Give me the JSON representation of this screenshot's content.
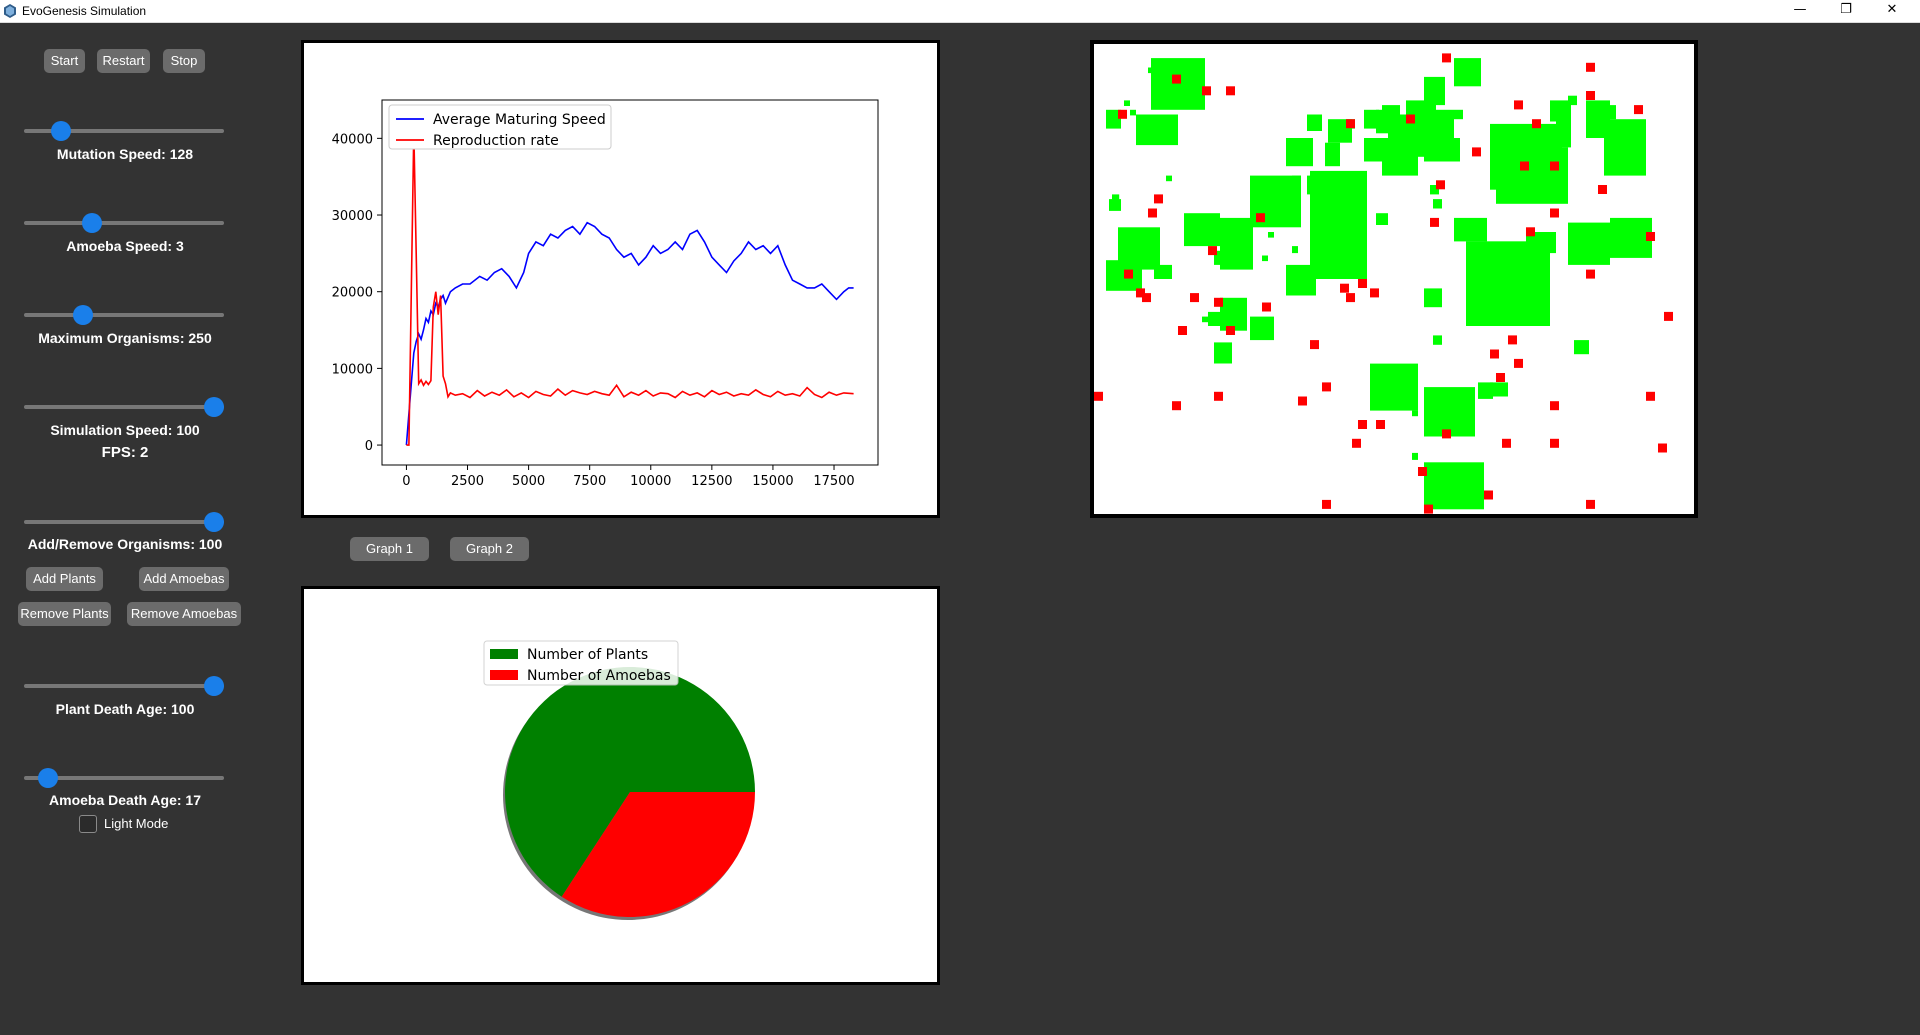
{
  "window": {
    "title": "EvoGenesis Simulation",
    "controls": {
      "minimize": "—",
      "restore": "❐",
      "close": "✕"
    }
  },
  "sidebar": {
    "buttons": {
      "start": "Start",
      "restart": "Restart",
      "stop": "Stop"
    },
    "sliders": {
      "mutation_speed": {
        "label": "Mutation Speed: 128",
        "level": 0.15
      },
      "amoeba_speed": {
        "label": "Amoeba Speed: 3",
        "level": 0.32
      },
      "max_organisms": {
        "label": "Maximum Organisms: 250",
        "level": 0.27
      },
      "simulation_speed": {
        "label": "Simulation Speed: 100",
        "level": 1.0
      },
      "add_remove": {
        "label": "Add/Remove Organisms: 100",
        "level": 1.0
      },
      "plant_death_age": {
        "label": "Plant Death Age: 100",
        "level": 1.0
      },
      "amoeba_death_age": {
        "label": "Amoeba Death Age: 17",
        "level": 0.08
      }
    },
    "fps": "FPS: 2",
    "organism_buttons": {
      "add_plants": "Add Plants",
      "add_amoebas": "Add Amoebas",
      "remove_plants": "Remove Plants",
      "remove_amoebas": "Remove Amoebas"
    },
    "light_mode": {
      "label": "Light Mode",
      "checked": false
    }
  },
  "graph_buttons": {
    "graph1": "Graph 1",
    "graph2": "Graph 2"
  },
  "colors": {
    "maturing": "#0000ff",
    "reproduction": "#ff0000",
    "plants": "#008000",
    "amoebas": "#ff0000",
    "grid_plant": "#00ff00",
    "grid_amoeba": "#ff0000",
    "slider_thumb": "#1a7fea",
    "background": "#333333"
  },
  "chart_data": [
    {
      "type": "line",
      "xlim": [
        -1000,
        19300
      ],
      "ylim": [
        -2600,
        45000
      ],
      "xticks": [
        0,
        2500,
        5000,
        7500,
        10000,
        12500,
        15000,
        17500
      ],
      "yticks": [
        0,
        10000,
        20000,
        30000,
        40000
      ],
      "legend_position": "upper-left",
      "series": [
        {
          "name": "Average Maturing Speed",
          "x": [
            0,
            200,
            300,
            400,
            500,
            600,
            700,
            800,
            900,
            1000,
            1100,
            1200,
            1300,
            1400,
            1500,
            1600,
            1800,
            2000,
            2300,
            2600,
            3000,
            3300,
            3600,
            3900,
            4200,
            4500,
            4800,
            5000,
            5300,
            5600,
            5900,
            6200,
            6500,
            6800,
            7100,
            7400,
            7700,
            8000,
            8300,
            8600,
            8900,
            9200,
            9500,
            9800,
            10100,
            10400,
            10700,
            11000,
            11300,
            11600,
            11900,
            12200,
            12500,
            12800,
            13100,
            13400,
            13700,
            14000,
            14300,
            14600,
            14900,
            15200,
            15500,
            15800,
            16100,
            16400,
            16700,
            17000,
            17300,
            17600,
            17900,
            18100,
            18300
          ],
          "y": [
            0,
            8000,
            12000,
            13500,
            14500,
            13800,
            15000,
            16500,
            16000,
            17500,
            17000,
            18500,
            18000,
            19000,
            19500,
            18500,
            20000,
            20500,
            21000,
            21000,
            22000,
            21500,
            22500,
            23000,
            22000,
            20500,
            22500,
            25000,
            26500,
            26000,
            27500,
            27000,
            28000,
            28500,
            27500,
            29000,
            28500,
            27500,
            27000,
            25500,
            24500,
            25000,
            23500,
            24500,
            26000,
            25000,
            25500,
            26500,
            25500,
            27500,
            28000,
            26500,
            24500,
            23500,
            22500,
            24000,
            25000,
            26500,
            25500,
            26000,
            25000,
            26000,
            23500,
            21500,
            21000,
            20500,
            20500,
            21000,
            20000,
            19000,
            20000,
            20500,
            20500
          ]
        },
        {
          "name": "Reproduction rate",
          "x": [
            0,
            100,
            200,
            300,
            400,
            500,
            600,
            700,
            800,
            900,
            1000,
            1100,
            1200,
            1300,
            1400,
            1500,
            1600,
            1700,
            1800,
            2000,
            2300,
            2600,
            2900,
            3200,
            3500,
            3800,
            4100,
            4400,
            4700,
            5000,
            5300,
            5600,
            5900,
            6200,
            6500,
            6800,
            7100,
            7400,
            7700,
            8000,
            8300,
            8600,
            8900,
            9200,
            9500,
            9800,
            10100,
            10400,
            10700,
            11000,
            11300,
            11600,
            11900,
            12200,
            12500,
            12800,
            13100,
            13400,
            13700,
            14000,
            14300,
            14600,
            14900,
            15200,
            15500,
            15800,
            16100,
            16400,
            16700,
            17000,
            17300,
            17600,
            17900,
            18300
          ],
          "y": [
            0,
            0,
            20000,
            41000,
            25000,
            8000,
            8500,
            7800,
            8300,
            7900,
            8400,
            18000,
            20000,
            17000,
            19500,
            9000,
            8000,
            6300,
            6800,
            6500,
            6700,
            6200,
            7100,
            6400,
            6900,
            6500,
            7200,
            6300,
            6800,
            6200,
            7000,
            6600,
            6400,
            7300,
            6500,
            7100,
            6800,
            6600,
            7000,
            6700,
            6500,
            7800,
            6300,
            6900,
            6500,
            7100,
            6400,
            6800,
            6700,
            6200,
            7000,
            6500,
            6800,
            6300,
            7100,
            6600,
            6900,
            6400,
            6700,
            6500,
            7200,
            6600,
            6300,
            7000,
            6500,
            6700,
            6400,
            7500,
            6600,
            6200,
            6900,
            6500,
            6800,
            6700
          ]
        }
      ]
    },
    {
      "type": "pie",
      "legend_position": "upper-left",
      "slices": [
        {
          "name": "Number of Plants",
          "value": 65.8
        },
        {
          "name": "Number of Amoebas",
          "value": 34.2
        }
      ]
    }
  ],
  "world": {
    "plants": [
      [
        0.095,
        0.03,
        0.09,
        0.11
      ],
      [
        0.07,
        0.15,
        0.07,
        0.065
      ],
      [
        0.02,
        0.14,
        0.025,
        0.04
      ],
      [
        0.13,
        0.05,
        0.012,
        0.015
      ],
      [
        0.09,
        0.05,
        0.01,
        0.012
      ],
      [
        0.06,
        0.14,
        0.01,
        0.012
      ],
      [
        0.03,
        0.32,
        0.012,
        0.02
      ],
      [
        0.025,
        0.33,
        0.02,
        0.025
      ],
      [
        0.02,
        0.46,
        0.06,
        0.065
      ],
      [
        0.04,
        0.39,
        0.07,
        0.09
      ],
      [
        0.1,
        0.47,
        0.03,
        0.03
      ],
      [
        0.15,
        0.36,
        0.06,
        0.07
      ],
      [
        0.21,
        0.37,
        0.055,
        0.11
      ],
      [
        0.2,
        0.44,
        0.015,
        0.03
      ],
      [
        0.26,
        0.28,
        0.085,
        0.11
      ],
      [
        0.33,
        0.28,
        0.015,
        0.025
      ],
      [
        0.355,
        0.28,
        0.03,
        0.04
      ],
      [
        0.36,
        0.27,
        0.095,
        0.23
      ],
      [
        0.36,
        0.3,
        0.02,
        0.03
      ],
      [
        0.32,
        0.47,
        0.05,
        0.065
      ],
      [
        0.21,
        0.54,
        0.045,
        0.07
      ],
      [
        0.26,
        0.58,
        0.04,
        0.05
      ],
      [
        0.2,
        0.635,
        0.03,
        0.045
      ],
      [
        0.19,
        0.57,
        0.02,
        0.03
      ],
      [
        0.32,
        0.2,
        0.045,
        0.06
      ],
      [
        0.355,
        0.15,
        0.025,
        0.035
      ],
      [
        0.42,
        0.16,
        0.015,
        0.02
      ],
      [
        0.39,
        0.16,
        0.04,
        0.05
      ],
      [
        0.385,
        0.21,
        0.025,
        0.05
      ],
      [
        0.45,
        0.14,
        0.025,
        0.04
      ],
      [
        0.47,
        0.14,
        0.035,
        0.05
      ],
      [
        0.45,
        0.2,
        0.05,
        0.05
      ],
      [
        0.48,
        0.13,
        0.03,
        0.03
      ],
      [
        0.49,
        0.15,
        0.07,
        0.09
      ],
      [
        0.48,
        0.22,
        0.06,
        0.06
      ],
      [
        0.55,
        0.2,
        0.06,
        0.05
      ],
      [
        0.55,
        0.07,
        0.035,
        0.06
      ],
      [
        0.52,
        0.12,
        0.05,
        0.06
      ],
      [
        0.56,
        0.14,
        0.04,
        0.06
      ],
      [
        0.6,
        0.03,
        0.045,
        0.06
      ],
      [
        0.66,
        0.17,
        0.12,
        0.14
      ],
      [
        0.67,
        0.22,
        0.12,
        0.12
      ],
      [
        0.76,
        0.12,
        0.035,
        0.045
      ],
      [
        0.77,
        0.15,
        0.025,
        0.07
      ],
      [
        0.82,
        0.12,
        0.04,
        0.08
      ],
      [
        0.85,
        0.16,
        0.07,
        0.12
      ],
      [
        0.85,
        0.13,
        0.02,
        0.03
      ],
      [
        0.68,
        0.27,
        0.03,
        0.03
      ],
      [
        0.6,
        0.37,
        0.055,
        0.05
      ],
      [
        0.62,
        0.42,
        0.14,
        0.18
      ],
      [
        0.65,
        0.42,
        0.09,
        0.14
      ],
      [
        0.72,
        0.4,
        0.05,
        0.045
      ],
      [
        0.79,
        0.38,
        0.07,
        0.09
      ],
      [
        0.86,
        0.37,
        0.07,
        0.085
      ],
      [
        0.73,
        0.27,
        0.03,
        0.03
      ],
      [
        0.55,
        0.52,
        0.03,
        0.04
      ],
      [
        0.47,
        0.36,
        0.02,
        0.025
      ],
      [
        0.56,
        0.3,
        0.015,
        0.02
      ],
      [
        0.565,
        0.33,
        0.015,
        0.02
      ],
      [
        0.8,
        0.63,
        0.025,
        0.03
      ],
      [
        0.46,
        0.68,
        0.08,
        0.1
      ],
      [
        0.55,
        0.73,
        0.085,
        0.105
      ],
      [
        0.64,
        0.72,
        0.025,
        0.035
      ],
      [
        0.66,
        0.72,
        0.03,
        0.03
      ],
      [
        0.55,
        0.89,
        0.1,
        0.1
      ],
      [
        0.53,
        0.87,
        0.01,
        0.015
      ],
      [
        0.57,
        0.82,
        0.01,
        0.012
      ],
      [
        0.53,
        0.78,
        0.01,
        0.012
      ],
      [
        0.05,
        0.12,
        0.01,
        0.012
      ],
      [
        0.79,
        0.11,
        0.015,
        0.02
      ],
      [
        0.565,
        0.62,
        0.015,
        0.02
      ],
      [
        0.6,
        0.14,
        0.015,
        0.02
      ],
      [
        0.33,
        0.43,
        0.01,
        0.015
      ],
      [
        0.28,
        0.45,
        0.01,
        0.012
      ],
      [
        0.29,
        0.4,
        0.01,
        0.012
      ],
      [
        0.18,
        0.58,
        0.01,
        0.012
      ],
      [
        0.03,
        0.16,
        0.01,
        0.015
      ],
      [
        0.12,
        0.28,
        0.01,
        0.012
      ]
    ],
    "amoebas": [
      [
        0.13,
        0.065
      ],
      [
        0.18,
        0.09
      ],
      [
        0.22,
        0.09
      ],
      [
        0.58,
        0.02
      ],
      [
        0.82,
        0.04
      ],
      [
        0.82,
        0.1
      ],
      [
        0.9,
        0.13
      ],
      [
        0.04,
        0.14
      ],
      [
        0.42,
        0.16
      ],
      [
        0.73,
        0.16
      ],
      [
        0.52,
        0.15
      ],
      [
        0.63,
        0.22
      ],
      [
        0.71,
        0.25
      ],
      [
        0.57,
        0.29
      ],
      [
        0.84,
        0.3
      ],
      [
        0.1,
        0.32
      ],
      [
        0.09,
        0.35
      ],
      [
        0.27,
        0.36
      ],
      [
        0.56,
        0.37
      ],
      [
        0.72,
        0.39
      ],
      [
        0.92,
        0.4
      ],
      [
        0.76,
        0.35
      ],
      [
        0.19,
        0.43
      ],
      [
        0.05,
        0.48
      ],
      [
        0.07,
        0.52
      ],
      [
        0.08,
        0.53
      ],
      [
        0.16,
        0.53
      ],
      [
        0.2,
        0.54
      ],
      [
        0.28,
        0.55
      ],
      [
        0.44,
        0.5
      ],
      [
        0.46,
        0.52
      ],
      [
        0.41,
        0.51
      ],
      [
        0.42,
        0.53
      ],
      [
        0.82,
        0.48
      ],
      [
        0.95,
        0.57
      ],
      [
        0.14,
        0.6
      ],
      [
        0.22,
        0.6
      ],
      [
        0.36,
        0.63
      ],
      [
        0.69,
        0.62
      ],
      [
        0.66,
        0.65
      ],
      [
        0.7,
        0.67
      ],
      [
        0.67,
        0.7
      ],
      [
        0.0,
        0.74
      ],
      [
        0.2,
        0.74
      ],
      [
        0.92,
        0.74
      ],
      [
        0.38,
        0.72
      ],
      [
        0.13,
        0.76
      ],
      [
        0.34,
        0.75
      ],
      [
        0.76,
        0.76
      ],
      [
        0.44,
        0.8
      ],
      [
        0.47,
        0.8
      ],
      [
        0.58,
        0.82
      ],
      [
        0.43,
        0.84
      ],
      [
        0.68,
        0.84
      ],
      [
        0.76,
        0.84
      ],
      [
        0.94,
        0.85
      ],
      [
        0.54,
        0.9
      ],
      [
        0.65,
        0.95
      ],
      [
        0.38,
        0.97
      ],
      [
        0.55,
        0.98
      ],
      [
        0.82,
        0.97
      ],
      [
        0.76,
        0.25
      ],
      [
        0.7,
        0.12
      ]
    ]
  }
}
